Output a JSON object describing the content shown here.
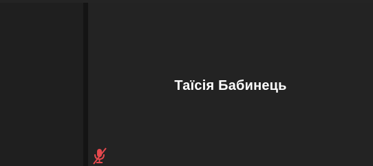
{
  "meeting": {
    "participant": {
      "name": "Таїсія Бабинець",
      "mic_status_icon": "muted-microphone-icon"
    }
  },
  "colors": {
    "background": "#1c1c1c",
    "tile": "#232323",
    "muted_indicator": "#e5484d",
    "name_text": "#ffffff"
  }
}
